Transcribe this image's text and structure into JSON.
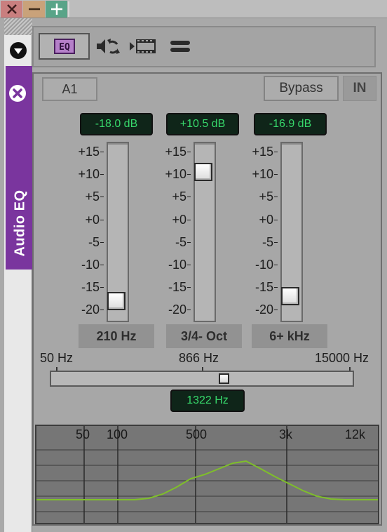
{
  "window": {
    "close_icon": "close-x-icon",
    "minimize_icon": "minus-icon",
    "maximize_icon": "plus-icon"
  },
  "sidebar": {
    "tab_label": "Audio EQ",
    "tab_color": "#7a359e"
  },
  "toolbar": {
    "eq_label": "EQ",
    "icons": [
      "eq-icon",
      "audio-sync-icon",
      "video-clip-icon",
      "menu-icon"
    ]
  },
  "panel": {
    "channel_button": "A1",
    "bypass_button": "Bypass",
    "in_button": "IN"
  },
  "bands": [
    {
      "gain_readout": "-18.0 dB",
      "gain_db": -18.0,
      "label": "210 Hz"
    },
    {
      "gain_readout": "+10.5 dB",
      "gain_db": 10.5,
      "label": "3/4- Oct"
    },
    {
      "gain_readout": "-16.9 dB",
      "gain_db": -16.9,
      "label": "6+ kHz"
    }
  ],
  "gain_scale": {
    "ticks": [
      "+15",
      "+10",
      "+5",
      "+0",
      "-5",
      "-10",
      "-15",
      "-20"
    ],
    "max_db": 15,
    "min_db": -20
  },
  "frequency": {
    "min_label": "50 Hz",
    "mid_label": "866 Hz",
    "max_label": "15000 Hz",
    "readout": "1322 Hz",
    "value_hz": 1322,
    "min_hz": 50,
    "max_hz": 15000
  },
  "response_graph": {
    "grid_labels": [
      "50",
      "100",
      "500",
      "3k",
      "12k"
    ],
    "curve_color": "#7fbf2a",
    "grid_color": "#3a3a3a",
    "background": "#767676"
  },
  "colors": {
    "readout_text": "#37d86b",
    "readout_bg": "#0f2519"
  }
}
